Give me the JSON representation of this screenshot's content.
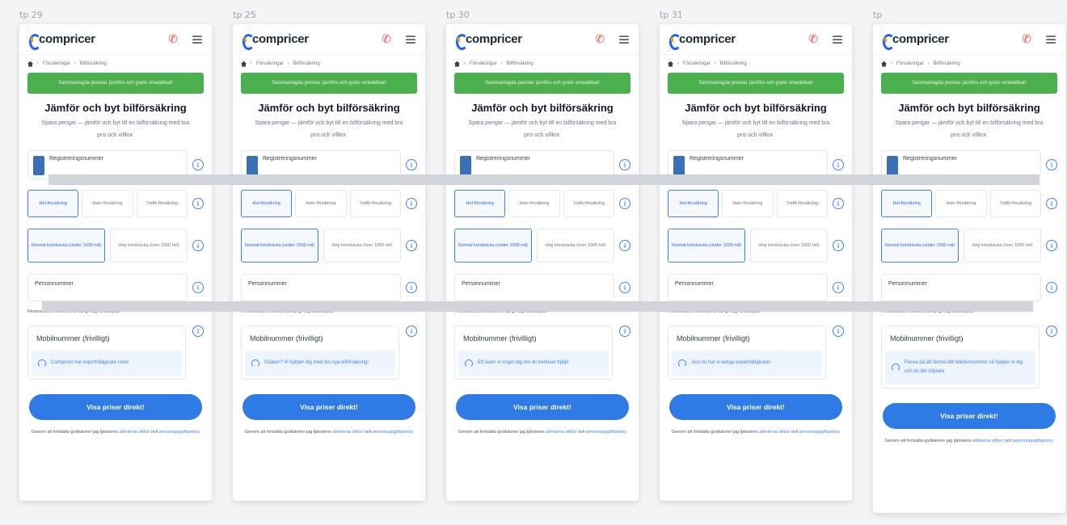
{
  "brand": "compricer",
  "colors": {
    "accent": "#2f7be5",
    "banner": "#4caf50",
    "phone_icon": "#ef4444"
  },
  "common": {
    "breadcrumb_1": "Försäkringar",
    "breadcrumb_2": "Bilförsäkring",
    "banner": "Sammanlagda premier jämförs och gratis omedelbart",
    "headline": "Jämför och byt bilförsäkring",
    "subline": "Spara pengar — jämför och byt till en bilförsäkring med bra pris och villkor.",
    "reg_label": "Registreringsnummer",
    "coverage_options": [
      "Hel-försäkring",
      "Halv-försäkring",
      "Trafik-försäkring"
    ],
    "mileage_options": [
      "Normal körsträcka (under 1000 mil)",
      "Hög körsträcka (över 1000 mil)"
    ],
    "pnr_label": "Personnummer",
    "pnr_note": "Personnumret behövs för att ge dig ett bra pris.",
    "mobile_label": "Mobilnummer (frivilligt)",
    "cta": "Visa priser direkt!",
    "legal_text": "Genom att fortsätta godkänner jag tjänstens",
    "legal_link_1": "allmänna villkor",
    "legal_and": "och",
    "legal_link_2": "personuppgiftspolicy"
  },
  "variants": [
    {
      "tag": "tp 29",
      "tip": "Compricer har expertrådgivare redo!"
    },
    {
      "tag": "tp 25",
      "tip": "Osäker? Vi hjälper dig med din nya bilförsäkring!"
    },
    {
      "tag": "tp 30",
      "tip": "Ett team vi ringer dig om du behöver hjälp!"
    },
    {
      "tag": "tp 31",
      "tip": "Just nu har vi lediga expertrådgivare!"
    },
    {
      "tag": "tp",
      "tip": "Passa på att lämna ditt telefonnummer så hjälper vi dig och du blir nöjdare."
    }
  ]
}
